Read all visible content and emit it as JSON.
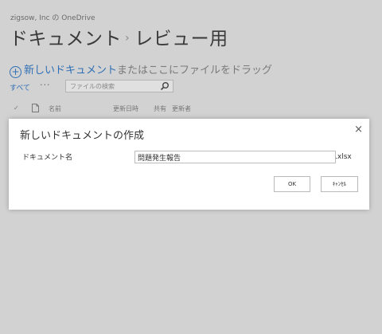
{
  "header": {
    "owner": "zigsow, Inc の OneDrive",
    "title_part1": "ドキュメント",
    "separator": "›",
    "title_part2": "レビュー用"
  },
  "command": {
    "new_link": "新しいドキュメント",
    "new_rest": "またはここにファイルをドラッグ"
  },
  "viewbar": {
    "all_label": "すべて",
    "more": "···",
    "search_placeholder": "ファイルの検索"
  },
  "columns": {
    "check": "✓",
    "name": "名前",
    "modified": "更新日時",
    "shared": "共有",
    "modified_by": "更新者"
  },
  "dialog": {
    "title": "新しいドキュメントの作成",
    "close": "×",
    "name_label": "ドキュメント名",
    "name_value": "問題発生報告",
    "extension": ".xlsx",
    "ok_label": "OK",
    "cancel_label": "ｷｬﾝｾﾙ"
  },
  "icons": [
    "add-circle-icon",
    "search-icon",
    "check-icon",
    "document-icon",
    "close-icon"
  ]
}
